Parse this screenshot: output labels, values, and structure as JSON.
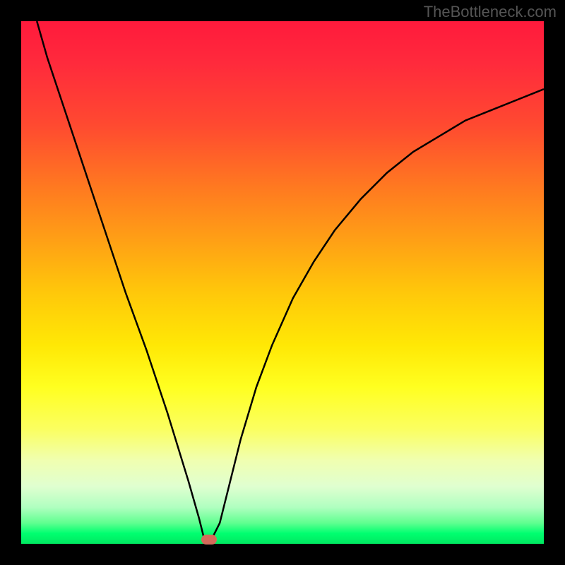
{
  "watermark": "TheBottleneck.com",
  "chart_data": {
    "type": "line",
    "title": "",
    "xlabel": "",
    "ylabel": "",
    "xlim": [
      0,
      100
    ],
    "ylim": [
      0,
      100
    ],
    "grid": false,
    "legend": false,
    "background_gradient": {
      "description": "Vertical gradient red (top, high bottleneck) to green (bottom, low bottleneck)",
      "stops": [
        {
          "pos": 0,
          "color": "#ff1a3c"
        },
        {
          "pos": 50,
          "color": "#ffc800"
        },
        {
          "pos": 100,
          "color": "#00e860"
        }
      ]
    },
    "series": [
      {
        "name": "bottleneck-curve",
        "color": "#000000",
        "x": [
          3,
          5,
          8,
          12,
          16,
          20,
          24,
          28,
          32,
          34,
          35,
          36,
          38,
          40,
          42,
          45,
          48,
          52,
          56,
          60,
          65,
          70,
          75,
          80,
          85,
          90,
          95,
          100
        ],
        "y": [
          100,
          93,
          84,
          72,
          60,
          48,
          37,
          25,
          12,
          5,
          1,
          0,
          4,
          12,
          20,
          30,
          38,
          47,
          54,
          60,
          66,
          71,
          75,
          78,
          81,
          83,
          85,
          87
        ]
      }
    ],
    "marker": {
      "name": "optimal-point",
      "x": 36,
      "y": 0,
      "color": "#d46a5a"
    }
  }
}
